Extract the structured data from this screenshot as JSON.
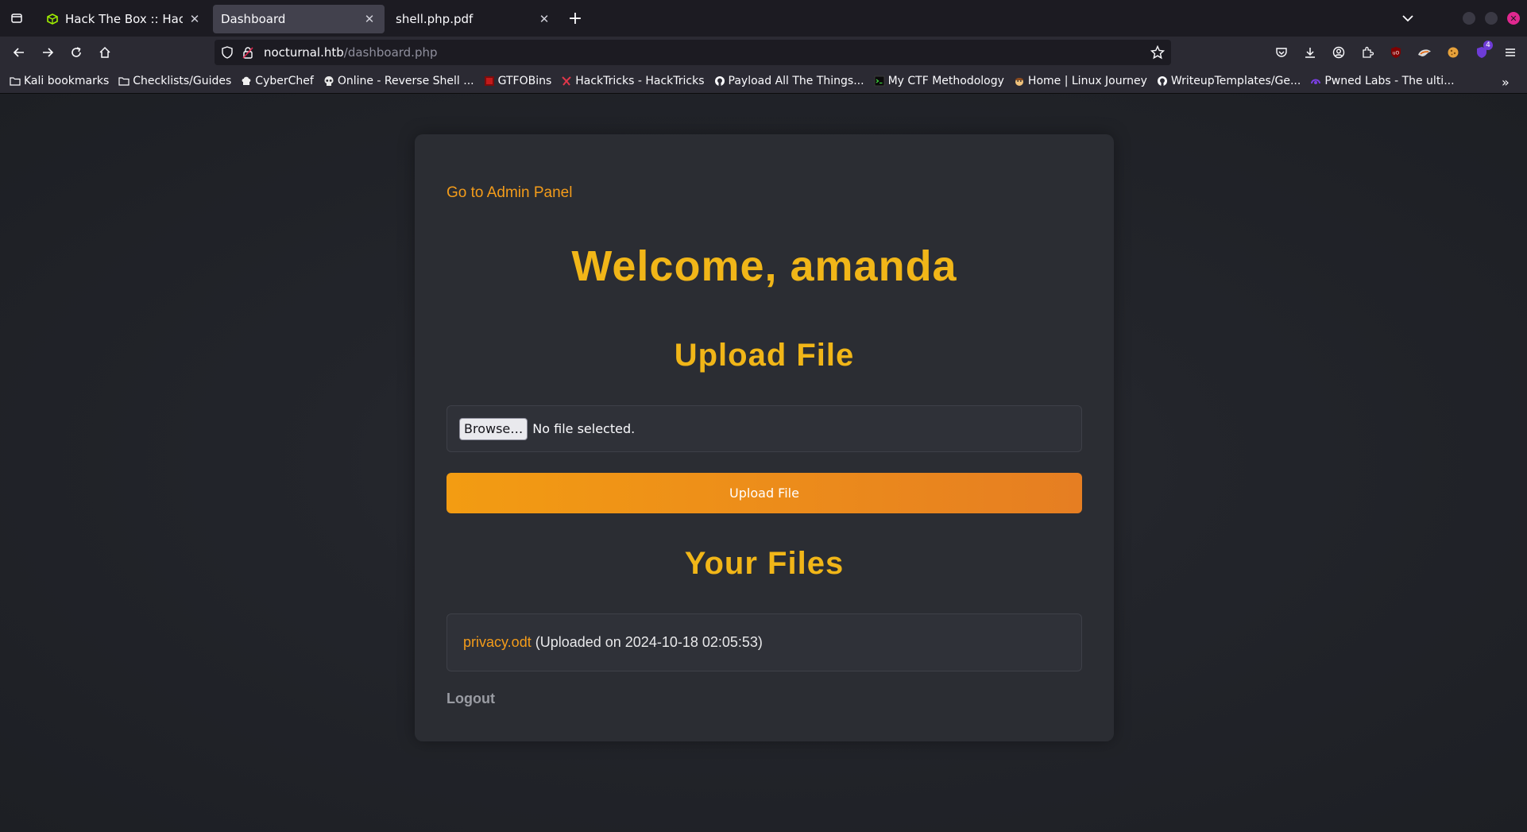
{
  "browser": {
    "tabs": [
      {
        "title": "Hack The Box :: Hack The",
        "favicon": "htb-cube-icon",
        "active": false
      },
      {
        "title": "Dashboard",
        "active": true
      },
      {
        "title": "shell.php.pdf",
        "active": false
      }
    ],
    "url": {
      "host": "nocturnal.htb",
      "path": "/dashboard.php"
    },
    "extension_badge": "4",
    "bookmarks": [
      {
        "label": "Kali bookmarks",
        "icon": "folder-icon"
      },
      {
        "label": "Checklists/Guides",
        "icon": "folder-icon"
      },
      {
        "label": "CyberChef",
        "icon": "chef-icon"
      },
      {
        "label": "Online - Reverse Shell ...",
        "icon": "skull-icon"
      },
      {
        "label": "GTFOBins",
        "icon": "gtfobins-icon"
      },
      {
        "label": "HackTricks - HackTricks",
        "icon": "hacktricks-icon"
      },
      {
        "label": "Payload All The Things...",
        "icon": "github-icon"
      },
      {
        "label": "My CTF Methodology",
        "icon": "terminal-icon"
      },
      {
        "label": "Home | Linux Journey",
        "icon": "linux-journey-icon"
      },
      {
        "label": "WriteupTemplates/Ge...",
        "icon": "github-icon"
      },
      {
        "label": "Pwned Labs - The ulti...",
        "icon": "pwnedlabs-icon"
      }
    ]
  },
  "page": {
    "admin_link": "Go to Admin Panel",
    "welcome": "Welcome, amanda",
    "upload_heading": "Upload File",
    "browse_label": "Browse…",
    "no_file_text": "No file selected.",
    "upload_button": "Upload File",
    "files_heading": "Your Files",
    "files": [
      {
        "name": "privacy.odt",
        "meta": "(Uploaded on 2024-10-18 02:05:53)"
      }
    ],
    "logout": "Logout"
  },
  "colors": {
    "accent_orange": "#f49c1a",
    "heading_yellow": "#f1b618",
    "card_bg": "#2b2d33"
  }
}
